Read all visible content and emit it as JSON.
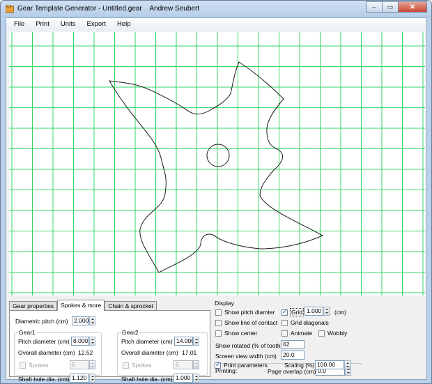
{
  "window": {
    "title": "Gear Template Generator - Untitled.gear    Andrew Seubert",
    "controls": {
      "minimize": "–",
      "maximize": "▭",
      "close": "✕"
    }
  },
  "menu": [
    "File",
    "Print",
    "Units",
    "Export",
    "Help"
  ],
  "colors": {
    "grid_line": "#33d466",
    "gear_outline": "#1a1a1a"
  },
  "tabs": [
    "Gear properties",
    "Spokes & more",
    "Chain & sprocket"
  ],
  "active_tab": "Spokes & more",
  "spokes_tab": {
    "diametric_pitch_label": "Diametric pitch  (cm)",
    "diametric_pitch_value": "2.000",
    "gear1": {
      "title": "Gear1",
      "pitch_diameter_label": "Pitch diameter (cm)",
      "pitch_diameter_value": "8.000",
      "overall_diameter_label": "Overall diameter (cm)",
      "overall_diameter_value": "12.52",
      "spokes_label": "Spokes",
      "spokes_value": "5",
      "shaft_hole_label": "Shaft hole dia.  (cm)",
      "shaft_hole_value": "1.120"
    },
    "gear2": {
      "title": "Gear2",
      "pitch_diameter_label": "Pitch diameter (cm)",
      "pitch_diameter_value": "14.000",
      "overall_diameter_label": "Overall diameter (cm)",
      "overall_diameter_value": "17.01",
      "spokes_label": "Spokes",
      "spokes_value": "5",
      "shaft_hole_label": "Shaft hole dia.  (cm)",
      "shaft_hole_value": "1.000"
    }
  },
  "display": {
    "title": "Display",
    "show_pitch_diameter": {
      "label": "Show pitch diamter",
      "checked": false
    },
    "show_line_of_contact": {
      "label": "Show line of contact",
      "checked": false
    },
    "show_center": {
      "label": "Show center",
      "checked": false
    },
    "grid": {
      "label": "Grid",
      "checked": true,
      "value": "1.000",
      "unit": "(cm)"
    },
    "grid_diagonals": {
      "label": "Grid diagonals",
      "checked": false
    },
    "animate": {
      "label": "Animate",
      "checked": false
    },
    "wobbly": {
      "label": "Wobbly",
      "checked": false
    },
    "show_rotated_label": "Show rotated (% of tooth)",
    "show_rotated_value": "62",
    "screen_view_width_label": "Screen view width (cm)",
    "screen_view_width_value": "20.0"
  },
  "printing": {
    "title": "Printing:",
    "page_overlap_label": "Page overlap (cm)",
    "page_overlap_value": "0.0",
    "print_parameters": {
      "label": "Print parameters",
      "checked": true
    },
    "scaling_label": "Scaling (%)",
    "scaling_value": "100.00"
  },
  "icons": {
    "app": "gear-app-icon",
    "minimize": "minimize-icon",
    "maximize": "maximize-icon",
    "close": "close-icon"
  }
}
